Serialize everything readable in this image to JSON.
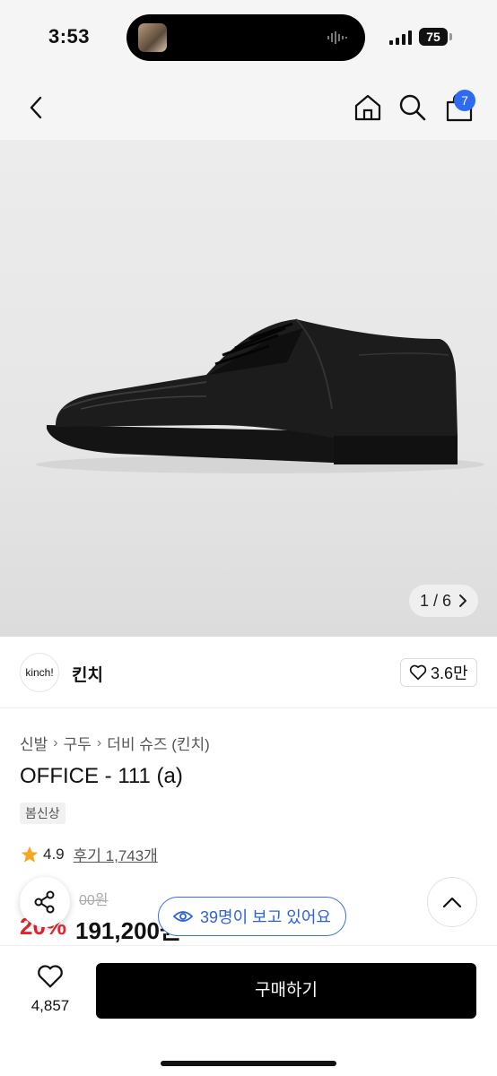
{
  "status": {
    "time": "3:53",
    "battery": "75"
  },
  "nav": {
    "cart_count": "7"
  },
  "gallery": {
    "position": "1 / 6"
  },
  "brand": {
    "logo_text": "kinch!",
    "name": "킨치",
    "likes": "3.6만"
  },
  "breadcrumb": [
    "신발",
    "구두",
    "더비 슈즈 (킨치)"
  ],
  "product": {
    "title": "OFFICE - 111 (a)",
    "tag": "봄신상",
    "rating": "4.9",
    "reviews": "후기 1,743개",
    "original_price": "00원",
    "discount": "20%",
    "price": "191,200원"
  },
  "viewers": {
    "label": "39명이 보고 있어요"
  },
  "bottom": {
    "wish_count": "4,857",
    "buy_label": "구매하기"
  },
  "colors": {
    "accent": "#2e6bf0",
    "discount": "#e8232f",
    "star": "#f5a623"
  }
}
